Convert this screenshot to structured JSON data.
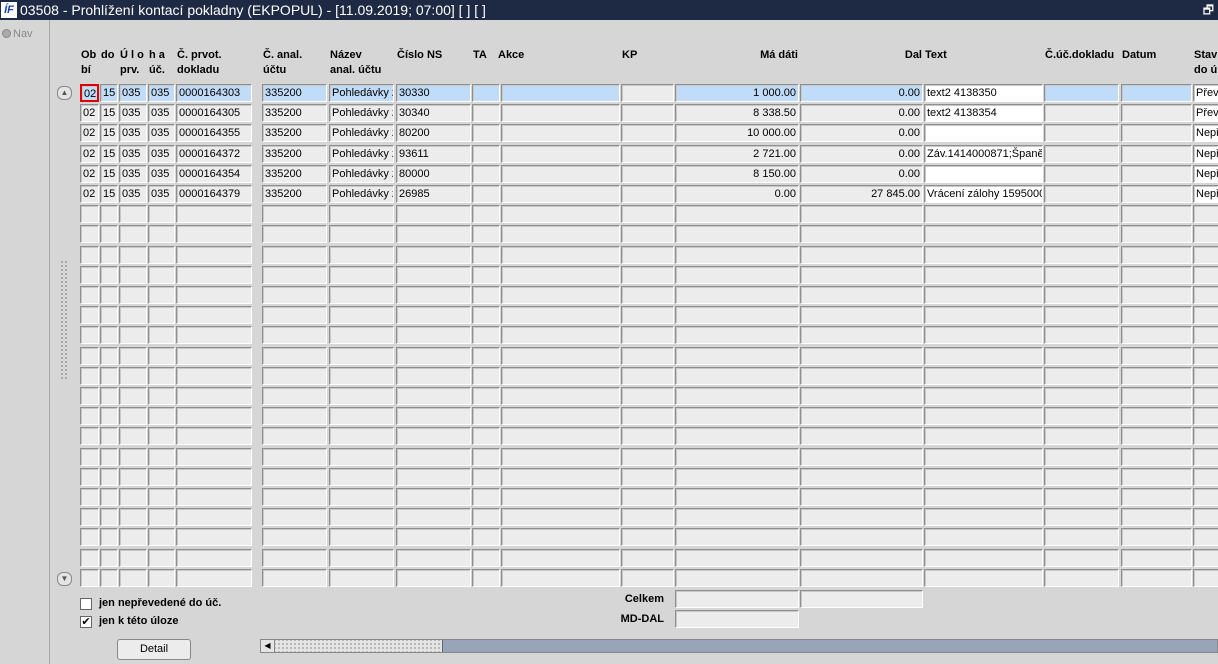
{
  "window": {
    "title": "03508 - Prohlížení kontací pokladny (EKPOPUL) - [11.09.2019; 07:00]  [ ]  [ ]",
    "logo": "ÍF",
    "restore_icon": "restore-icon"
  },
  "nav": {
    "label": "Nav"
  },
  "columns": [
    {
      "key": "ob",
      "label1": "Ob",
      "label2": "bí"
    },
    {
      "key": "do",
      "label1": "do",
      "label2": ""
    },
    {
      "key": "ulo",
      "label1": "Ú l o",
      "label2": "prv."
    },
    {
      "key": "ha",
      "label1": "h a",
      "label2": "úč."
    },
    {
      "key": "prvot",
      "label1": "Č. prvot.",
      "label2": "dokladu"
    },
    {
      "key": "anal",
      "label1": "Č. anal.",
      "label2": "účtu"
    },
    {
      "key": "nazev",
      "label1": "Název",
      "label2": "anal. účtu"
    },
    {
      "key": "ns",
      "label1": "Číslo NS",
      "label2": ""
    },
    {
      "key": "ta",
      "label1": "TA",
      "label2": ""
    },
    {
      "key": "akce",
      "label1": "Akce",
      "label2": ""
    },
    {
      "key": "kp",
      "label1": "KP",
      "label2": ""
    },
    {
      "key": "md",
      "label1": "Má dáti",
      "label2": ""
    },
    {
      "key": "dal",
      "label1": "Dal",
      "label2": ""
    },
    {
      "key": "text",
      "label1": "Text",
      "label2": ""
    },
    {
      "key": "ucdok",
      "label1": "Č.úč.dokladu",
      "label2": ""
    },
    {
      "key": "datum",
      "label1": "Datum",
      "label2": ""
    },
    {
      "key": "stav",
      "label1": "Stav",
      "label2": "do ú"
    }
  ],
  "rows": [
    {
      "ob": "02",
      "do": "15",
      "ulo": "035",
      "ha": "035",
      "prvot": "0000164303",
      "anal": "335200",
      "nazev": "Pohledávky z",
      "ns": "30330",
      "ta": "",
      "akce": "",
      "kp": "",
      "md": "1 000.00",
      "dal": "0.00",
      "text": "text2 4138350",
      "ucdok": "",
      "datum": "",
      "stav": "Přev"
    },
    {
      "ob": "02",
      "do": "15",
      "ulo": "035",
      "ha": "035",
      "prvot": "0000164305",
      "anal": "335200",
      "nazev": "Pohledávky z",
      "ns": "30340",
      "ta": "",
      "akce": "",
      "kp": "",
      "md": "8 338.50",
      "dal": "0.00",
      "text": "text2 4138354",
      "ucdok": "",
      "datum": "",
      "stav": "Přev"
    },
    {
      "ob": "02",
      "do": "15",
      "ulo": "035",
      "ha": "035",
      "prvot": "0000164355",
      "anal": "335200",
      "nazev": "Pohledávky z",
      "ns": "80200",
      "ta": "",
      "akce": "",
      "kp": "",
      "md": "10 000.00",
      "dal": "0.00",
      "text": "",
      "ucdok": "",
      "datum": "",
      "stav": "Nepř"
    },
    {
      "ob": "02",
      "do": "15",
      "ulo": "035",
      "ha": "035",
      "prvot": "0000164372",
      "anal": "335200",
      "nazev": "Pohledávky z",
      "ns": "93611",
      "ta": "",
      "akce": "",
      "kp": "",
      "md": "2 721.00",
      "dal": "0.00",
      "text": "Záv.1414000871;Španě",
      "ucdok": "",
      "datum": "",
      "stav": "Nepř"
    },
    {
      "ob": "02",
      "do": "15",
      "ulo": "035",
      "ha": "035",
      "prvot": "0000164354",
      "anal": "335200",
      "nazev": "Pohledávky z",
      "ns": "80000",
      "ta": "",
      "akce": "",
      "kp": "",
      "md": "8 150.00",
      "dal": "0.00",
      "text": "",
      "ucdok": "",
      "datum": "",
      "stav": "Nepř"
    },
    {
      "ob": "02",
      "do": "15",
      "ulo": "035",
      "ha": "035",
      "prvot": "0000164379",
      "anal": "335200",
      "nazev": "Pohledávky z",
      "ns": "26985",
      "ta": "",
      "akce": "",
      "kp": "",
      "md": "0.00",
      "dal": "27 845.00",
      "text": "Vrácení zálohy 1595000",
      "ucdok": "",
      "datum": "",
      "stav": "Nepř"
    }
  ],
  "empty_rows": 19,
  "filters": {
    "neprevedene": {
      "label": "jen nepřevedené do úč.",
      "checked": false
    },
    "uloze": {
      "label": "jen k této úloze",
      "checked": true
    }
  },
  "totals": {
    "celkem_label": "Celkem",
    "celkem_md": "",
    "celkem_dal": "",
    "mddal_label": "MD-DAL",
    "mddal_value": ""
  },
  "buttons": {
    "detail": "Detail"
  },
  "colors": {
    "selected_row": "#c0dcf8",
    "titlebar": "#1e2a44"
  }
}
